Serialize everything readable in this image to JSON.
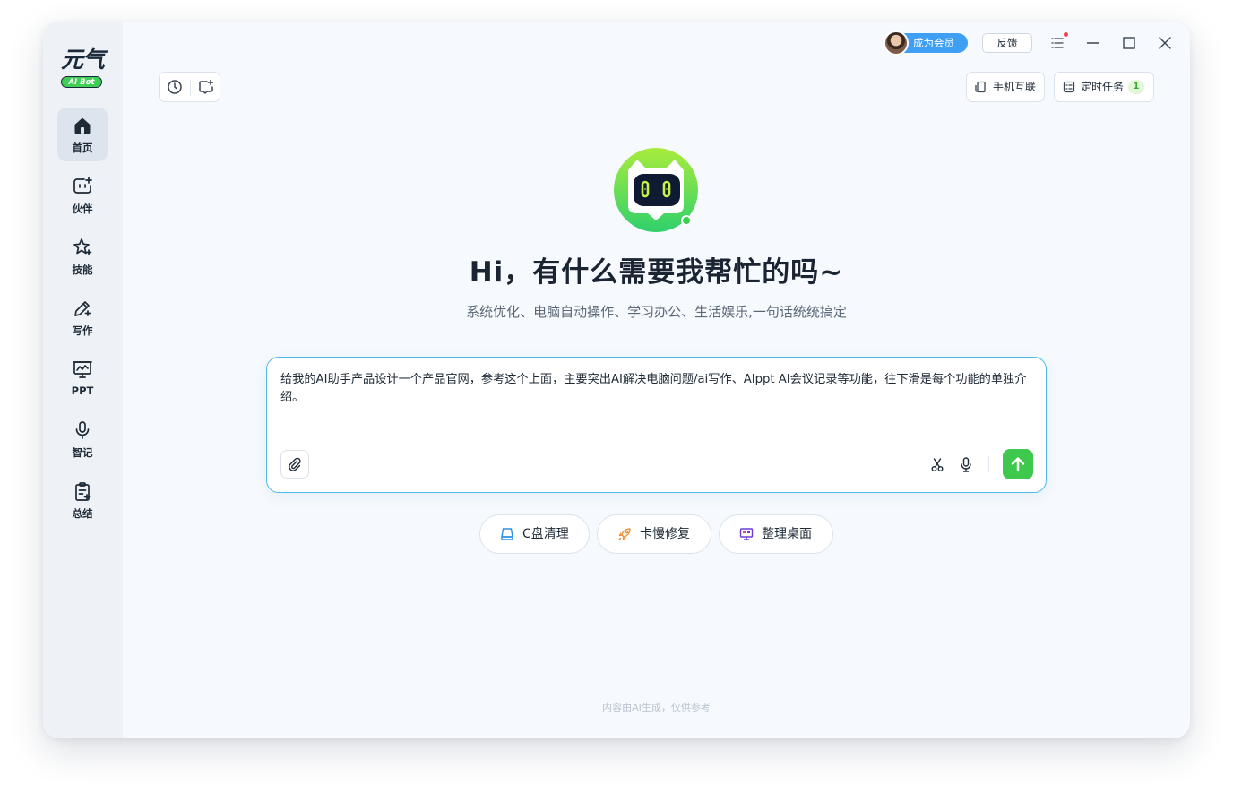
{
  "app": {
    "logo_text": "元气",
    "logo_badge": "AI Bot",
    "member_label": "成为会员",
    "feedback_label": "反馈"
  },
  "sidebar": {
    "items": [
      {
        "label": "首页",
        "icon": "home-icon",
        "active": true
      },
      {
        "label": "伙伴",
        "icon": "companion-icon",
        "active": false
      },
      {
        "label": "技能",
        "icon": "skills-icon",
        "active": false
      },
      {
        "label": "写作",
        "icon": "writing-icon",
        "active": false
      },
      {
        "label": "PPT",
        "icon": "ppt-icon",
        "active": false
      },
      {
        "label": "智记",
        "icon": "microphone-icon",
        "active": false
      },
      {
        "label": "总结",
        "icon": "summary-icon",
        "active": false
      }
    ]
  },
  "toolbar": {
    "history_icon": "history-icon",
    "new_chat_icon": "new-chat-icon",
    "phone_link_label": "手机互联",
    "scheduled_tasks_label": "定时任务",
    "scheduled_tasks_count": "1"
  },
  "main": {
    "greeting": "Hi，有什么需要我帮忙的吗~",
    "subtitle": "系统优化、电脑自动操作、学习办公、生活娱乐,一句话统统搞定",
    "input_value": "给我的AI助手产品设计一个产品官网，参考这个上面，主要突出AI解决电脑问题/ai写作、AIppt AI会议记录等功能，往下滑是每个功能的单独介绍。",
    "quick_actions": [
      {
        "label": "C盘清理",
        "icon": "disk-icon"
      },
      {
        "label": "卡慢修复",
        "icon": "rocket-icon"
      },
      {
        "label": "整理桌面",
        "icon": "desktop-icon"
      }
    ],
    "footer_note": "内容由AI生成，仅供参考"
  },
  "colors": {
    "accent_blue": "#3f9ff5",
    "send_green": "#3fc84e",
    "input_border": "#4fb9e6",
    "notification_dot": "#f04848"
  }
}
